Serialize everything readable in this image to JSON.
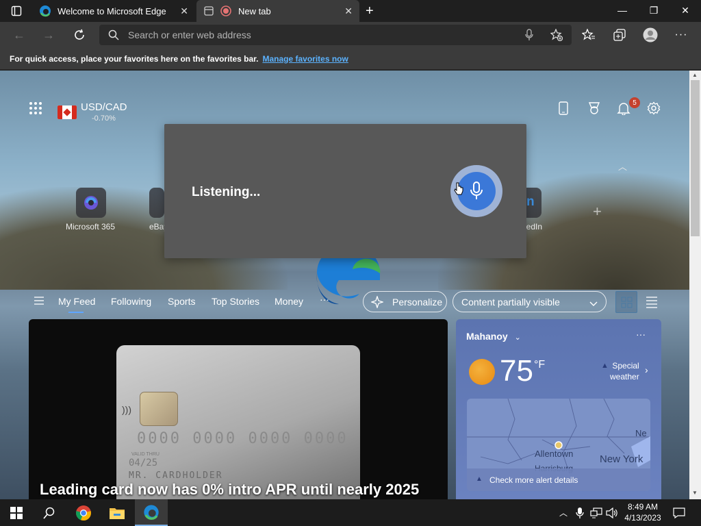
{
  "browser": {
    "tabs": [
      {
        "title": "Welcome to Microsoft Edge",
        "active": false
      },
      {
        "title": "New tab",
        "active": true
      }
    ],
    "address_placeholder": "Search or enter web address",
    "favorites_bar": {
      "message": "For quick access, place your favorites here on the favorites bar.",
      "link": "Manage favorites now"
    }
  },
  "newtab": {
    "currency": {
      "pair": "USD/CAD",
      "change": "-0.70%"
    },
    "notifications_count": "5",
    "quick_links": [
      {
        "label": "Microsoft 365"
      },
      {
        "label": "eBay"
      },
      {
        "label": "LinkedIn"
      }
    ],
    "listening_overlay": {
      "text": "Listening..."
    },
    "feed_nav": {
      "tabs": [
        "My Feed",
        "Following",
        "Sports",
        "Top Stories",
        "Money"
      ],
      "more": "···",
      "personalize": "Personalize",
      "content_visibility": "Content partially visible"
    },
    "hero_card": {
      "title": "Leading card now has 0% intro APR until nearly 2025",
      "card_number": "0000 0000 0000 0000",
      "valid_thru_label": "VALID THRU",
      "valid_date": "04/25",
      "holder": "MR. CARDHOLDER"
    },
    "weather": {
      "location": "Mahanoy",
      "temperature": "75",
      "unit": "°F",
      "alert": [
        "Special",
        "weather"
      ],
      "map_labels": [
        "Allentown",
        "New York",
        "Harrisburg",
        "Ne"
      ],
      "map_alert": "Check more alert details",
      "more": "···"
    }
  },
  "taskbar": {
    "time": "8:49 AM",
    "date": "4/13/2023"
  },
  "colors": {
    "accent": "#3b78d8",
    "link": "#5cb3ff",
    "badge": "#c4412e"
  }
}
